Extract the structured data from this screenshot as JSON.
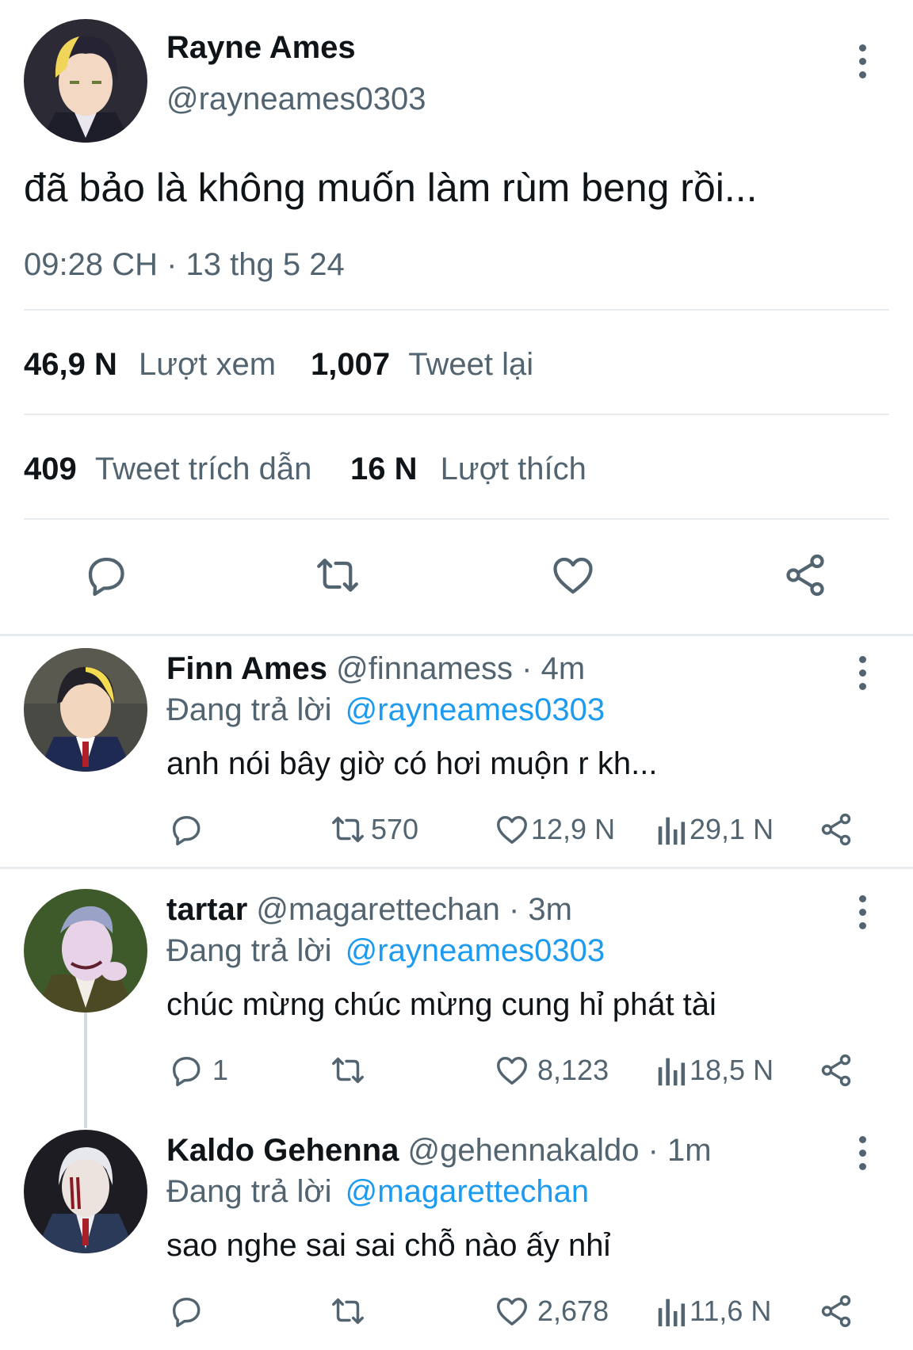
{
  "tweet": {
    "author_name": "Rayne Ames",
    "author_handle": "@rayneames0303",
    "text": "đã bảo là không muốn làm rùm beng rồi...",
    "timestamp": "09:28 CH · 13 thg 5 24",
    "stats": {
      "views_count": "46,9 N",
      "views_label": "Lượt xem",
      "retweets_count": "1,007",
      "retweets_label": "Tweet lại",
      "quotes_count": "409",
      "quotes_label": "Tweet trích dẫn",
      "likes_count": "16 N",
      "likes_label": "Lượt thích"
    },
    "actions": [
      "reply-icon",
      "retweet-icon",
      "heart-icon",
      "share-icon"
    ]
  },
  "replying_label": "Đang trả lời",
  "replies": [
    {
      "name": "Finn Ames",
      "handle": "@finnamess",
      "time": "· 4m",
      "reply_to": "@rayneames0303",
      "text": "anh nói bây giờ có hơi muộn r kh...",
      "reply_count": "",
      "retweet_count": "570",
      "like_count": "12,9 N",
      "view_count": "29,1 N"
    },
    {
      "name": "tartar",
      "handle": "@magarettechan",
      "time": "· 3m",
      "reply_to": "@rayneames0303",
      "text": "chúc mừng chúc mừng cung hỉ phát tài",
      "reply_count": "1",
      "retweet_count": "",
      "like_count": "8,123",
      "view_count": "18,5 N"
    },
    {
      "name": "Kaldo Gehenna",
      "handle": "@gehennakaldo",
      "time": "· 1m",
      "reply_to": "@magarettechan",
      "text": "sao nghe sai sai chỗ nào ấy nhỉ",
      "reply_count": "",
      "retweet_count": "",
      "like_count": "2,678",
      "view_count": "11,6 N"
    }
  ],
  "colors": {
    "text": "#0f1419",
    "secondary": "#536471",
    "link": "#1d9bf0",
    "divider": "#e8ecef"
  }
}
